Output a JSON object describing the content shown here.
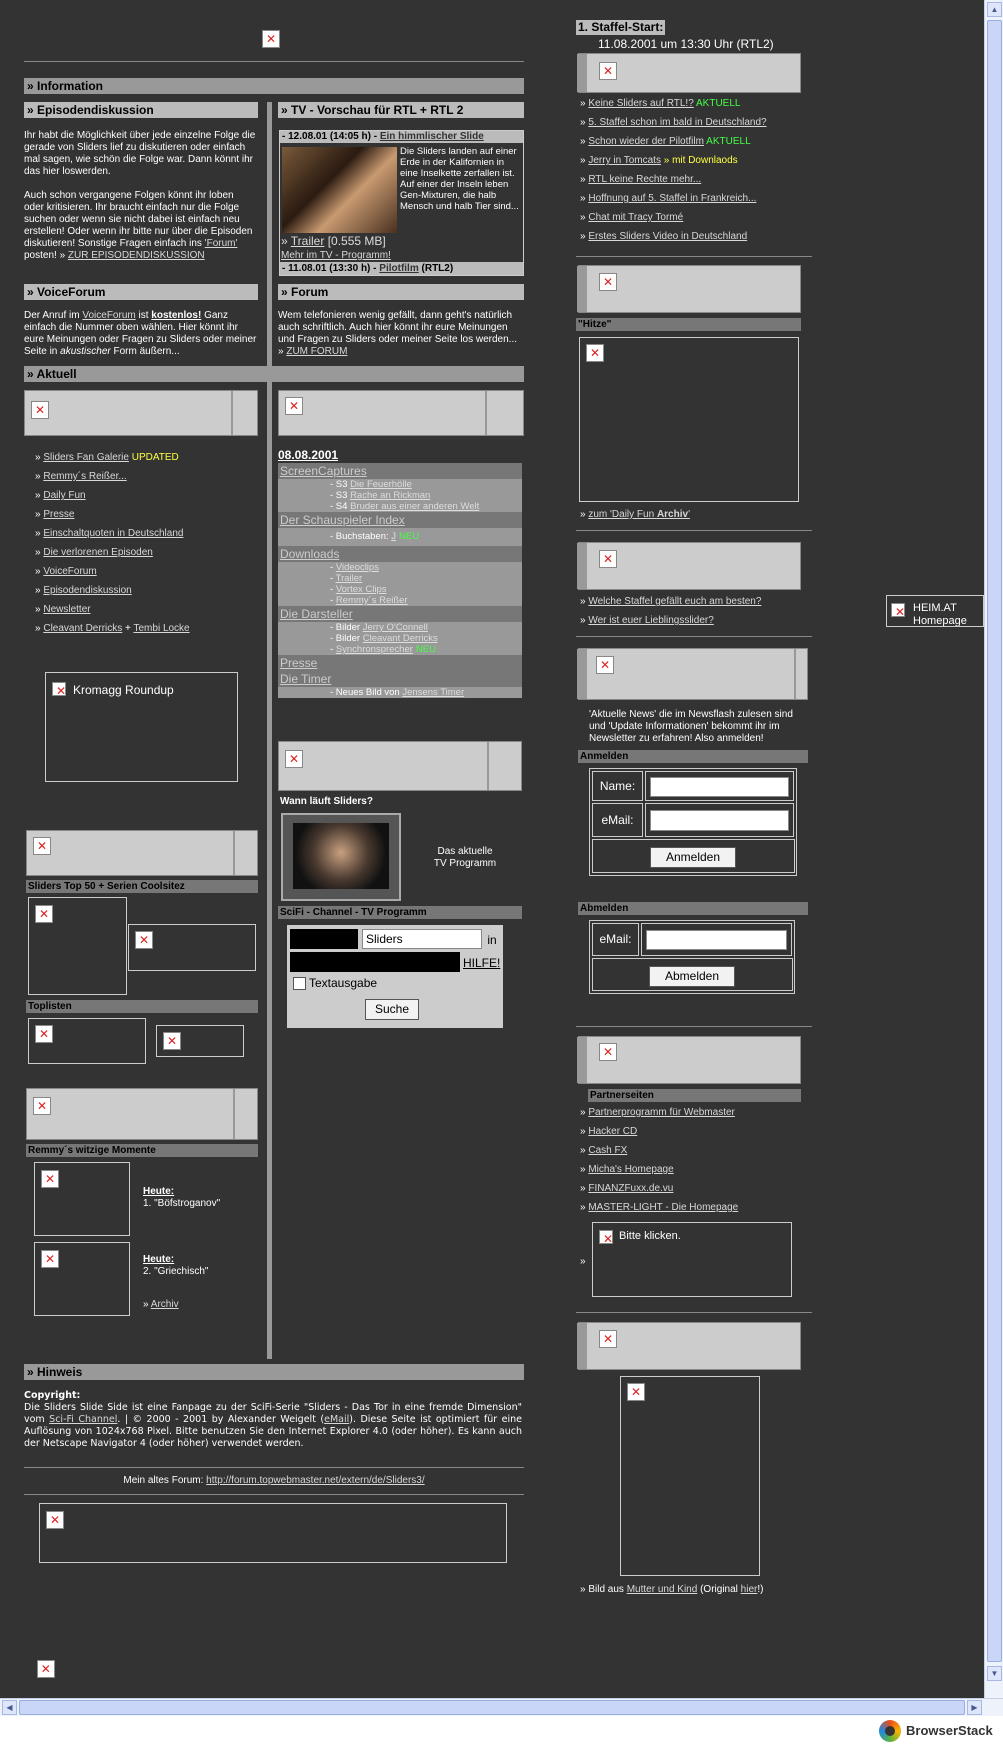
{
  "staffel": {
    "title": "1. Staffel-Start:",
    "date": "11.08.2001 um 13:30 Uhr (RTL2)"
  },
  "info": {
    "header": "» Information",
    "episode": {
      "header": "» Episodendiskussion",
      "p1": "Ihr habt die Möglichkeit über jede einzelne Folge die gerade von Sliders lief zu diskutieren oder einfach mal sagen, wie schön die Folge war. Dann könnt ihr das hier loswerden.",
      "p2a": "Auch schon vergangene Folgen könnt ihr loben oder kritisieren. Ihr braucht einfach nur die Folge suchen oder wenn sie nicht dabei ist einfach neu erstellen! Oder wenn ihr bitte nur über die Episoden diskutieren! Sonstige Fragen einfach ins ",
      "forum": "'Forum'",
      "p2b": " posten! » ",
      "link": "ZUR EPISODENDISKUSSION"
    },
    "tv": {
      "header": "» TV - Vorschau für RTL + RTL 2",
      "line1a": "- 12.08.01 (14:05 h) - ",
      "line1b": "Ein himmlischer Slide",
      "desc": "Die Sliders landen auf einer Erde in der Kalifornien in eine Inselkette zerfallen ist. Auf einer der Inseln leben Gen-Mixturen, die halb Mensch und halb Tier sind...",
      "trailer": "Trailer",
      "size": "[0.555 MB]",
      "more": "Mehr im TV - Programm!",
      "line2a": "- 11.08.01 (13:30 h) - ",
      "line2b": "Pilotfilm",
      "line2c": " (RTL2)"
    },
    "voice": {
      "header": "» VoiceForum",
      "t1": "Der Anruf im ",
      "t2": "VoiceForum",
      "t3": " ist ",
      "t4": "kostenlos!",
      "t5": " Ganz einfach die Nummer oben wählen. Hier könnt ihr eure Meinungen oder Fragen zu Sliders oder meiner Seite in ",
      "t6": "akustischer",
      "t7": " Form äußern..."
    },
    "forum": {
      "header": "» Forum",
      "text": "Wem telefonieren wenig gefällt, dann geht's natürlich auch schriftlich. Auch hier könnt ihr eure Meinungen und Fragen zu Sliders oder meiner Seite los werden... » ",
      "link": "ZUM FORUM"
    }
  },
  "aktuell": {
    "header": "» Aktuell"
  },
  "leftlinks": [
    {
      "t": "Sliders Fan Galerie",
      "x": " UPDATED",
      "c": "y"
    },
    {
      "t": "Remmy´s Reißer...",
      "x": "",
      "c": ""
    },
    {
      "t": "Daily Fun",
      "x": "",
      "c": ""
    },
    {
      "t": "Presse",
      "x": "",
      "c": ""
    },
    {
      "t": "Einschaltquoten in Deutschland",
      "x": "",
      "c": ""
    },
    {
      "t": "Die verlorenen Episoden",
      "x": "",
      "c": ""
    },
    {
      "t": "VoiceForum",
      "x": "",
      "c": ""
    },
    {
      "t": "Episodendiskussion",
      "x": "",
      "c": ""
    },
    {
      "t": "Newsletter",
      "x": "",
      "c": ""
    },
    {
      "t": "Cleavant Derricks",
      "x": " + ",
      "c": "w",
      "t2": "Tembi Locke"
    }
  ],
  "kromagg": "Kromagg Roundup",
  "left": {
    "top50": "Sliders Top 50 + Serien Coolsitez",
    "toplisten": "Toplisten",
    "remmy": "Remmy´s witzige Momente",
    "heute": "Heute:",
    "m1": "1. \"Böfstroganov\"",
    "m2": "2. \"Griechisch\"",
    "archiv": "Archiv"
  },
  "mid": {
    "date": "08.08.2001",
    "sections": [
      {
        "h": "ScreenCaptures",
        "rows": [
          [
            "- S3 ",
            "Die Feuerhölle"
          ],
          [
            "- S3 ",
            "Rache an Rickman"
          ],
          [
            "- S4 ",
            "Bruder aus einer anderen Welt"
          ]
        ]
      },
      {
        "h": "Der Schauspieler Index",
        "rows": [
          [
            "- Buchstaben: ",
            "J",
            "NEU"
          ]
        ]
      },
      {
        "h": "Downloads",
        "rows": [
          [
            "- ",
            "Videoclips"
          ],
          [
            "- ",
            "Trailer"
          ],
          [
            "- ",
            "Vortex Clips"
          ],
          [
            "- ",
            "Remmy´s Reißer"
          ]
        ]
      },
      {
        "h": "Die Darsteller",
        "rows": [
          [
            "- Bilder ",
            "Jerry O'Connell"
          ],
          [
            "- Bilder ",
            "Cleavant Derricks"
          ],
          [
            "- ",
            "Synchronsprecher",
            "NEU"
          ]
        ]
      },
      {
        "h": "Presse",
        "rows": []
      },
      {
        "h": "Die Timer",
        "rows": [
          [
            "- Neues Bild von ",
            "Jensens Timer"
          ]
        ]
      }
    ],
    "wann": "Wann läuft Sliders?",
    "aktuelle1": "Das aktuelle",
    "aktuelle2": "TV Programm",
    "scifi": "SciFi - Channel - TV Programm",
    "search_value": "Sliders",
    "in": "in",
    "hilfe": "HILFE!",
    "textausgabe": "Textausgabe",
    "suche": "Suche"
  },
  "right": {
    "news": [
      {
        "t": "Keine Sliders auf RTL!?",
        "x": " AKTUELL",
        "c": "g"
      },
      {
        "t": "5. Staffel schon im bald in Deutschland?",
        "x": "",
        "c": ""
      },
      {
        "t": "Schon wieder der Pilotfilm",
        "x": " AKTUELL",
        "c": "g"
      },
      {
        "t": "Jerry in Tomcats",
        "x": " » mit Downlaods",
        "c": "y"
      },
      {
        "t": "RTL keine Rechte mehr...",
        "x": "",
        "c": ""
      },
      {
        "t": "Hoffnung auf 5. Staffel in Frankreich...",
        "x": "",
        "c": ""
      },
      {
        "t": "Chat mit Tracy Tormé",
        "x": "",
        "c": ""
      },
      {
        "t": "Erstes Sliders Video in Deutschland",
        "x": "",
        "c": ""
      }
    ],
    "hitze": "\"Hitze\"",
    "dailyfun_pre": "zum 'Daily Fun ",
    "dailyfun_b": "Archiv",
    "dailyfun_post": "'",
    "polls": [
      "Welche Staffel gefällt euch am besten?",
      "Wer ist euer Lieblingsslider?"
    ],
    "newsletter": "'Aktuelle News' die im Newsflash zulesen sind und 'Update Informationen' bekommt ihr im Newsletter zu erfahren! Also anmelden!",
    "anmelden_h": "Anmelden",
    "name_label": "Name:",
    "email_label": "eMail:",
    "anmelden_btn": "Anmelden",
    "abmelden_h": "Abmelden",
    "abmelden_btn": "Abmelden",
    "partner_h": "Partnerseiten",
    "partners": [
      "Partnerprogramm für Webmaster",
      "Hacker CD",
      "Cash FX",
      "Micha's Homepage",
      "FINANZFuxx.de.vu",
      "MASTER-LIGHT - Die Homepage"
    ],
    "bitte": "Bitte klicken.",
    "bild_a": "Bild aus ",
    "bild_b": "Mutter und Kind",
    "bild_c": " (Original ",
    "bild_d": "hier",
    "bild_e": "!)"
  },
  "heim": {
    "t1": "HEIM.AT",
    "t2": "Homepage"
  },
  "hinweis": {
    "header": "» Hinweis",
    "copyright": "Copyright:",
    "t1": "Die Sliders Slide Side ist eine Fanpage zu der SciFi-Serie \"Sliders - Das Tor in eine fremde Dimension\" vom ",
    "t2": "Sci-Fi Channel",
    "t3": ". | © 2000 - 2001 by Alexander Weigelt (",
    "t4": "eMail",
    "t5": "). Diese Seite ist optimiert für eine Auflösung von 1024x768 Pixel. Bitte benutzen Sie den Internet Explorer 4.0 (oder höher). Es kann auch der Netscape Navigator 4 (oder höher) verwendet werden.",
    "forum_pre": "Mein altes Forum: ",
    "forum_url": "http://forum.topwebmaster.net/extern/de/Sliders3/"
  },
  "browserstack": "BrowserStack"
}
